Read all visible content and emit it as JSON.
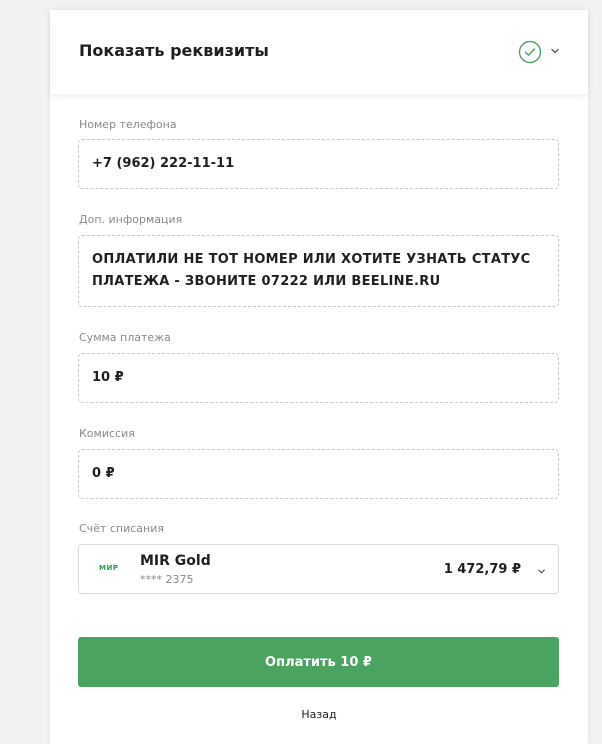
{
  "header": {
    "title": "Показать реквизиты"
  },
  "fields": {
    "phone": {
      "label": "Номер телефона",
      "value": "+7 (962) 222-11-11"
    },
    "info": {
      "label": "Доп. информация",
      "line1": "ОПЛАТИЛИ НЕ ТОТ НОМЕР ИЛИ ХОТИТЕ УЗНАТЬ СТАТУС",
      "line2": "ПЛАТЕЖА - ЗВОНИТЕ 07222 ИЛИ BEELINE.RU"
    },
    "amount": {
      "label": "Сумма платежа",
      "value": "10 ₽"
    },
    "commission": {
      "label": "Комиссия",
      "value": "0 ₽"
    }
  },
  "account": {
    "label": "Счёт списания",
    "logo": "МИР",
    "name": "MIR Gold",
    "number": "**** 2375",
    "balance": "1 472,79 ₽"
  },
  "actions": {
    "pay_label": "Оплатить 10 ₽",
    "back_label": "Назад"
  },
  "colors": {
    "accent_green": "#4aa35f",
    "mir_green": "#2e9c4a"
  },
  "icons": {
    "header_status": "check-circle-icon",
    "header_toggle": "chevron-down-icon",
    "account_toggle": "chevron-down-icon"
  }
}
